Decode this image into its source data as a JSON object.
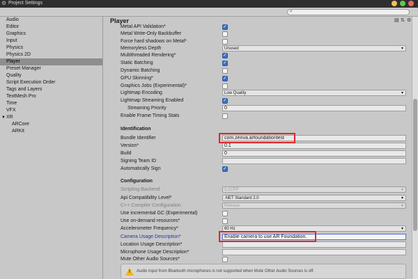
{
  "window": {
    "title": "Project Settings"
  },
  "colors": {
    "accent": "#3c6fc3",
    "highlight_box": "#e0262b",
    "selected_bg": "#8e8e8e",
    "warning": "#f2b51c"
  },
  "sidebar": {
    "items": [
      {
        "label": "Audio"
      },
      {
        "label": "Editor"
      },
      {
        "label": "Graphics"
      },
      {
        "label": "Input"
      },
      {
        "label": "Physics"
      },
      {
        "label": "Physics 2D"
      },
      {
        "label": "Player"
      },
      {
        "label": "Preset Manager"
      },
      {
        "label": "Quality"
      },
      {
        "label": "Script Execution Order"
      },
      {
        "label": "Tags and Layers"
      },
      {
        "label": "TextMesh Pro"
      },
      {
        "label": "Time"
      },
      {
        "label": "VFX"
      },
      {
        "label": "XR"
      },
      {
        "label": "ARCore"
      },
      {
        "label": "ARKit"
      }
    ],
    "selected": "Player"
  },
  "panel": {
    "title": "Player"
  },
  "rows": {
    "metal_api_validation": {
      "label": "Metal API Validation*",
      "checked": true
    },
    "metal_write_only": {
      "label": "Metal Write-Only Backbuffer",
      "checked": false
    },
    "force_hard_shadows": {
      "label": "Force hard shadows on Metal*",
      "checked": false
    },
    "memoryless_depth": {
      "label": "Memoryless Depth",
      "value": "Unused"
    },
    "multithreaded_rendering": {
      "label": "Multithreaded Rendering*",
      "checked": true
    },
    "static_batching": {
      "label": "Static Batching",
      "checked": true
    },
    "dynamic_batching": {
      "label": "Dynamic Batching",
      "checked": false
    },
    "gpu_skinning": {
      "label": "GPU Skinning*",
      "checked": true
    },
    "graphics_jobs": {
      "label": "Graphics Jobs (Experimental)*",
      "checked": false
    },
    "lightmap_encoding": {
      "label": "Lightmap Encoding",
      "value": "Low Quality"
    },
    "lightmap_streaming": {
      "label": "Lightmap Streaming Enabled",
      "checked": true
    },
    "streaming_priority": {
      "label": "Streaming Priority",
      "value": "0"
    },
    "frame_timing_stats": {
      "label": "Enable Frame Timing Stats",
      "checked": false
    }
  },
  "identification": {
    "heading": "Identification",
    "bundle_identifier": {
      "label": "Bundle Identifier",
      "value": "com.zenva.arfoundationtest"
    },
    "version": {
      "label": "Version*",
      "value": "0.1"
    },
    "build": {
      "label": "Build",
      "value": "0"
    },
    "signing_team_id": {
      "label": "Signing Team ID",
      "value": ""
    },
    "automatically_sign": {
      "label": "Automatically Sign",
      "checked": true
    }
  },
  "configuration": {
    "heading": "Configuration",
    "scripting_backend": {
      "label": "Scripting Backend",
      "value": "IL2CPP"
    },
    "api_compat": {
      "label": "Api Compatibility Level*",
      "value": ".NET Standard 2.0"
    },
    "cpp_compiler": {
      "label": "C++ Compiler Configuration",
      "value": "Release"
    },
    "incremental_gc": {
      "label": "Use incremental GC (Experimental)",
      "checked": false
    },
    "on_demand_resources": {
      "label": "Use on-demand resources*",
      "checked": false
    },
    "accelerometer_frequency": {
      "label": "Accelerometer Frequency*",
      "value": "60 Hz"
    },
    "camera_usage": {
      "label": "Camera Usage Description*",
      "value": "Enable camera to use AR Foundation."
    },
    "location_usage": {
      "label": "Location Usage Description*",
      "value": ""
    },
    "microphone_usage": {
      "label": "Microphone Usage Description*",
      "value": ""
    },
    "mute_other_audio": {
      "label": "Mute Other Audio Sources*",
      "checked": false
    }
  },
  "help": {
    "message": "Audio input from Bluetooth microphones is not supported when Mute Other Audio Sources is off."
  }
}
